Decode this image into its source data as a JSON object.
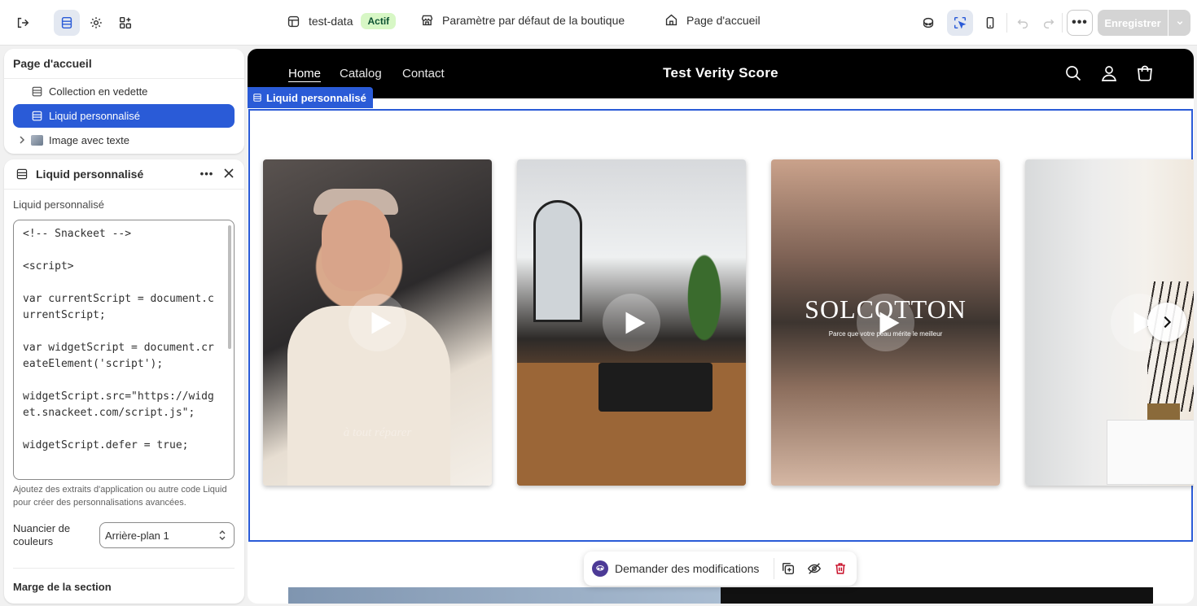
{
  "topbar": {
    "store_name": "test-data",
    "store_status": "Actif",
    "theme_settings_label": "Paramètre par défaut de la boutique",
    "page_label": "Page d'accueil",
    "more_label": "•••",
    "save_label": "Enregistrer"
  },
  "sections_panel": {
    "title": "Page d'accueil",
    "items": [
      {
        "label": "Collection en vedette"
      },
      {
        "label": "Liquid personnalisé"
      },
      {
        "label": "Image avec texte"
      }
    ]
  },
  "settings_panel": {
    "title": "Liquid personnalisé",
    "dots": "•••",
    "field_label": "Liquid personnalisé",
    "code": "<!-- Snackeet -->\n\n<script>\n\nvar currentScript = document.currentScript;\n\nvar widgetScript = document.createElement('script');\n\nwidgetScript.src=\"https://widget.snackeet.com/script.js\";\n\nwidgetScript.defer = true;",
    "help": "Ajoutez des extraits d'application ou autre code Liquid pour créer des personnalisations avancées.",
    "swatch_label": "Nuancier de couleurs",
    "swatch_value": "Arrière-plan 1",
    "section_margin_label": "Marge de la section"
  },
  "preview": {
    "nav": [
      "Home",
      "Catalog",
      "Contact"
    ],
    "store_title": "Test Verity Score",
    "selected_tag": "Liquid personnalisé",
    "videos": [
      {
        "caption": "à tout réparer"
      },
      {
        "caption": ""
      },
      {
        "overlay_title": "SOLCOTTON",
        "overlay_sub": "Parce que votre peau mérite le meilleur"
      },
      {
        "caption": ""
      }
    ]
  },
  "floating_toolbar": {
    "ask_label": "Demander des modifications"
  },
  "colors": {
    "accent": "#2a5bd7",
    "active_badge_bg": "#d7f7c5",
    "save_disabled": "#d4d4d4",
    "store_header_bg": "#000000",
    "delete": "#c70a24"
  }
}
